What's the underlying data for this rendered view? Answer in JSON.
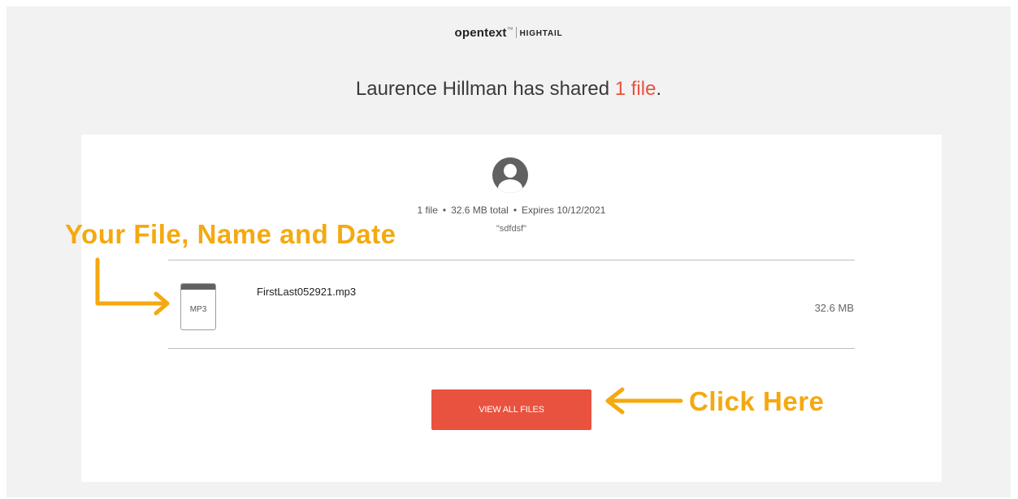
{
  "brand": {
    "primary": "opentext",
    "trademark": "™",
    "secondary": "HIGHTAIL"
  },
  "headline": {
    "prefix": "Laurence Hillman has shared ",
    "count": "1 file",
    "suffix": "."
  },
  "share": {
    "file_count": "1 file",
    "total_size": "32.6 MB total",
    "expires": "Expires 10/12/2021",
    "separator": "•",
    "message": "\"sdfdsf\""
  },
  "file": {
    "extension": "MP3",
    "name": "FirstLast052921.mp3",
    "size": "32.6 MB"
  },
  "actions": {
    "view_all_label": "VIEW ALL FILES"
  },
  "annotations": {
    "file_callout": "Your File, Name and Date",
    "button_callout": "Click Here"
  },
  "colors": {
    "accent": "#e8523f",
    "annotation": "#f5a90f",
    "page_background": "#f2f2f2"
  }
}
